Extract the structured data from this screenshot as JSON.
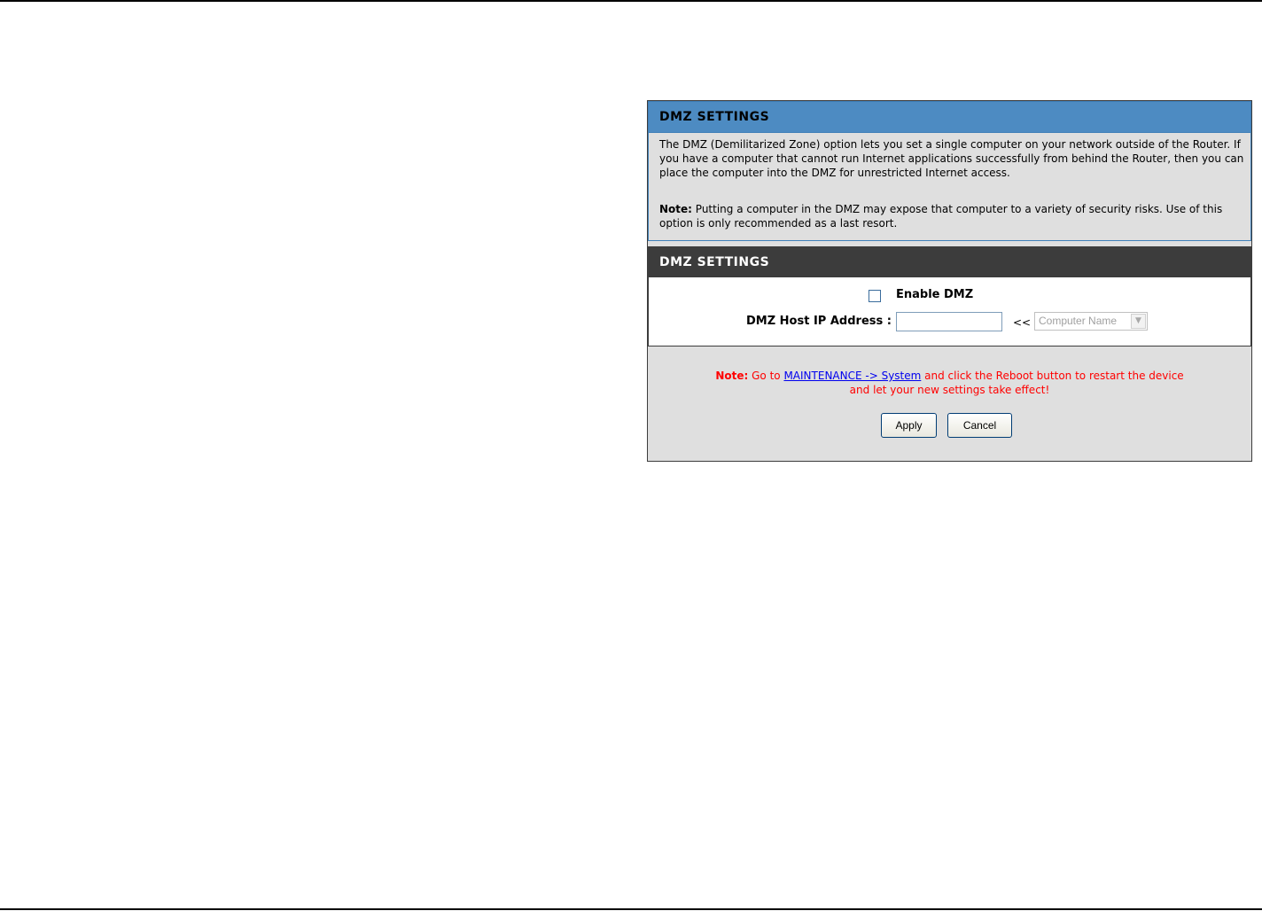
{
  "info": {
    "title": "DMZ SETTINGS",
    "description": "The DMZ (Demilitarized Zone) option lets you set a single computer on your network outside of the Router. If you have a computer that cannot run Internet applications successfully from behind the Router, then you can place the computer into the DMZ for unrestricted Internet access.",
    "note_label": "Note:",
    "note_text": "Putting a computer in the DMZ may expose that computer to a variety of security risks. Use of this option is only recommended as a last resort."
  },
  "form": {
    "title": "DMZ SETTINGS",
    "enable_label": "Enable DMZ",
    "enable_checked": false,
    "ip_label": "DMZ Host IP Address :",
    "ip_value": "",
    "arrows": "<<",
    "computer_select": "Computer Name"
  },
  "footer": {
    "note_label": "Note:",
    "note_prefix": "Go to",
    "link_text": "MAINTENANCE -> System",
    "note_suffix": "and click the Reboot button to restart the device",
    "note_line2": "and let your new settings take effect!",
    "apply_label": "Apply",
    "cancel_label": "Cancel"
  },
  "colors": {
    "info_header": "#4d8bc2",
    "form_header": "#3c3c3c",
    "note_red": "#ff0000",
    "link_blue": "#0000ee"
  }
}
